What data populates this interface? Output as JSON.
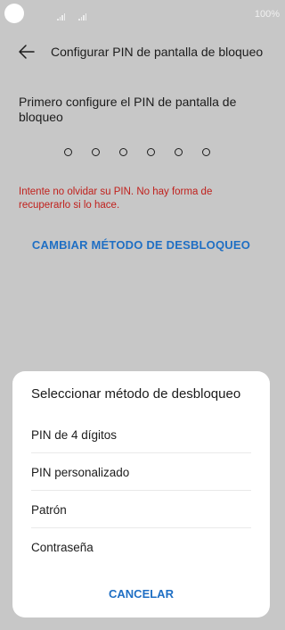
{
  "status_bar": {
    "battery": "100%"
  },
  "header": {
    "title": "Configurar PIN de pantalla de bloqueo"
  },
  "instruction": "Primero configure el PIN de pantalla de bloqueo",
  "pin_length": 6,
  "warning": "Intente no olvidar su PIN. No hay forma de recuperarlo si lo hace.",
  "change_method_label": "CAMBIAR MÉTODO DE DESBLOQUEO",
  "sheet": {
    "title": "Seleccionar método de desbloqueo",
    "options": [
      {
        "label": "PIN de 4 dígitos"
      },
      {
        "label": "PIN personalizado"
      },
      {
        "label": "Patrón"
      },
      {
        "label": "Contraseña"
      }
    ],
    "cancel_label": "CANCELAR"
  },
  "colors": {
    "accent": "#1f6fc4",
    "warning": "#c0211d",
    "dim_background": "#c7c7c7"
  }
}
